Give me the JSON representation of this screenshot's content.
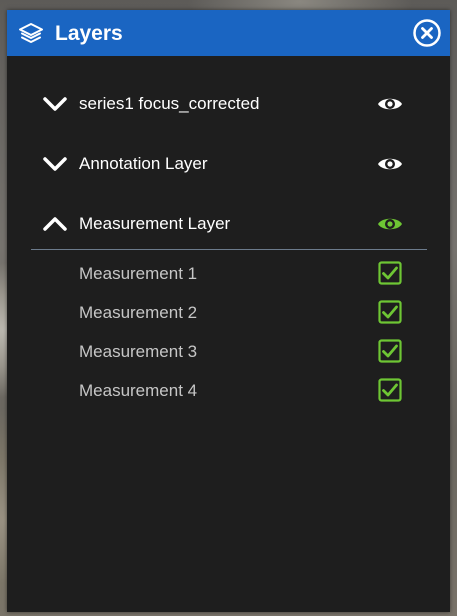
{
  "panel": {
    "title": "Layers",
    "header_color": "#1a65c2",
    "icons": {
      "title_icon": "layers-icon",
      "close_icon": "close-circle-icon"
    }
  },
  "layers": [
    {
      "label": "series1 focus_corrected",
      "expanded": false,
      "visible": true,
      "eye_color": "#ffffff"
    },
    {
      "label": "Annotation Layer",
      "expanded": false,
      "visible": true,
      "eye_color": "#ffffff"
    },
    {
      "label": "Measurement Layer",
      "expanded": true,
      "visible": true,
      "eye_color": "#6ec634"
    }
  ],
  "measurements": [
    {
      "label": "Measurement 1",
      "checked": true
    },
    {
      "label": "Measurement 2",
      "checked": true
    },
    {
      "label": "Measurement 3",
      "checked": true
    },
    {
      "label": "Measurement 4",
      "checked": true
    }
  ],
  "accent_green": "#6ec634"
}
